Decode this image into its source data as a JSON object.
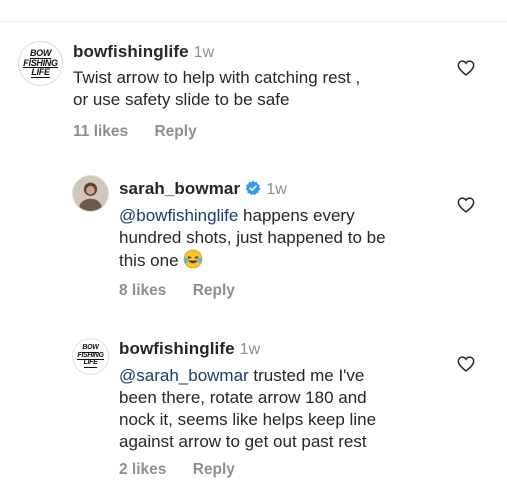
{
  "comments": [
    {
      "username": "bowfishinglife",
      "time": "1w",
      "verified": false,
      "avatar_logo": [
        "BOW",
        "FISHING",
        "LIFE"
      ],
      "lines": [
        "Twist arrow to help with catching rest ,",
        "or use safety slide to be safe"
      ],
      "likes": "11 likes",
      "reply": "Reply"
    },
    {
      "username": "sarah_bowmar",
      "time": "1w",
      "verified": true,
      "mention": "@bowfishinglife",
      "lines": [
        " happens every",
        "hundred shots, just happened to be",
        "this one "
      ],
      "emoji": "laughing-tears-emoji",
      "likes": "8 likes",
      "reply": "Reply"
    },
    {
      "username": "bowfishinglife",
      "time": "1w",
      "verified": false,
      "avatar_logo": [
        "BOW",
        "FISHING",
        "LIFE"
      ],
      "mention": "@sarah_bowmar",
      "lines": [
        " trusted me I've",
        "been there, rotate arrow 180 and",
        "nock it, seems like helps keep line",
        "against arrow to get out past rest"
      ],
      "likes": "2 likes",
      "reply": "Reply"
    }
  ],
  "colors": {
    "text": "#262626",
    "muted": "#8e8e8e",
    "mention": "#1f3b6b",
    "verified": "#3897f0"
  },
  "icons": [
    "heart-outline-icon",
    "verified-badge-icon"
  ]
}
